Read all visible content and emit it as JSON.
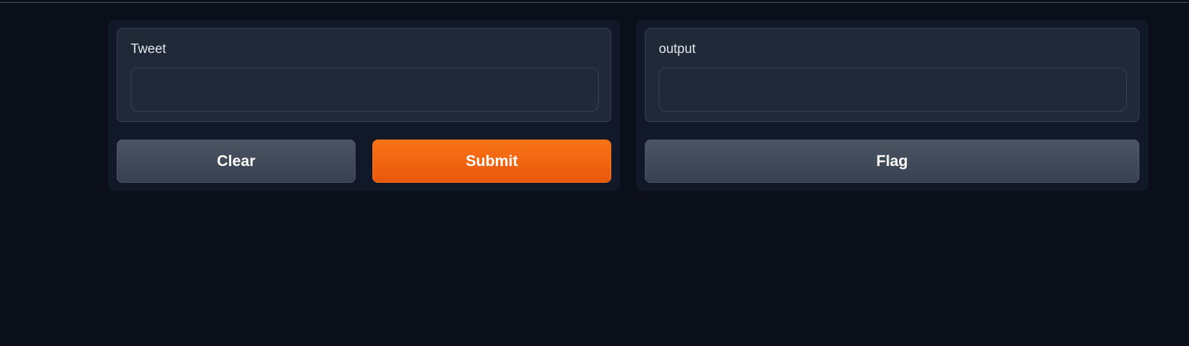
{
  "input_panel": {
    "field_label": "Tweet",
    "field_value": "",
    "clear_label": "Clear",
    "submit_label": "Submit"
  },
  "output_panel": {
    "field_label": "output",
    "field_value": "",
    "flag_label": "Flag"
  },
  "colors": {
    "background": "#0b0f19",
    "panel": "#111827",
    "block": "#1f2937",
    "border": "#374151",
    "primary_button": "#f97316",
    "secondary_button": "#4b5563"
  }
}
